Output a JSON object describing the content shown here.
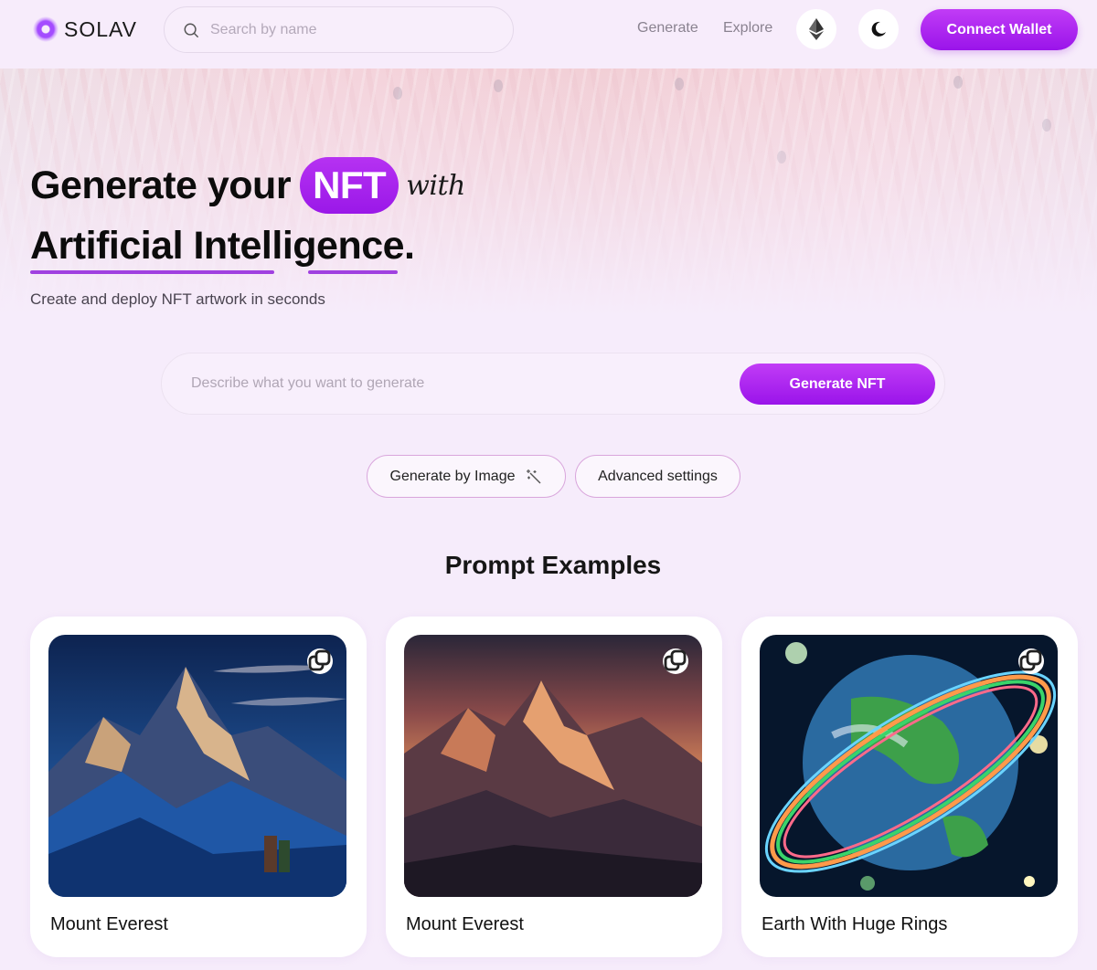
{
  "header": {
    "brand": "SOLAV",
    "search_placeholder": "Search by name",
    "nav": [
      {
        "label": "Generate"
      },
      {
        "label": "Explore"
      }
    ],
    "network_icon": "ethereum-icon",
    "theme_icon": "moon-icon",
    "connect_label": "Connect Wallet"
  },
  "hero": {
    "title_part1": "Generate your",
    "title_highlight": "NFT",
    "title_with": "with",
    "title_line2": "Artificial Intelligence.",
    "subtitle": "Create and deploy NFT artwork in seconds"
  },
  "prompt": {
    "placeholder": "Describe what you want to generate",
    "value": "",
    "generate_label": "Generate NFT"
  },
  "options": {
    "by_image_label": "Generate by Image",
    "by_image_icon": "magic-wand-icon",
    "advanced_label": "Advanced settings"
  },
  "examples": {
    "title": "Prompt Examples",
    "cards": [
      {
        "title": "Mount Everest",
        "image": "night-sky mountain peak with climbers"
      },
      {
        "title": "Mount Everest",
        "image": "sunset mountain peak"
      },
      {
        "title": "Earth With Huge Rings",
        "image": "earth with colorful rings in space"
      }
    ]
  },
  "colors": {
    "accent": "#a61ff0",
    "background": "#f6ecfb",
    "underline": "#a040e0"
  }
}
